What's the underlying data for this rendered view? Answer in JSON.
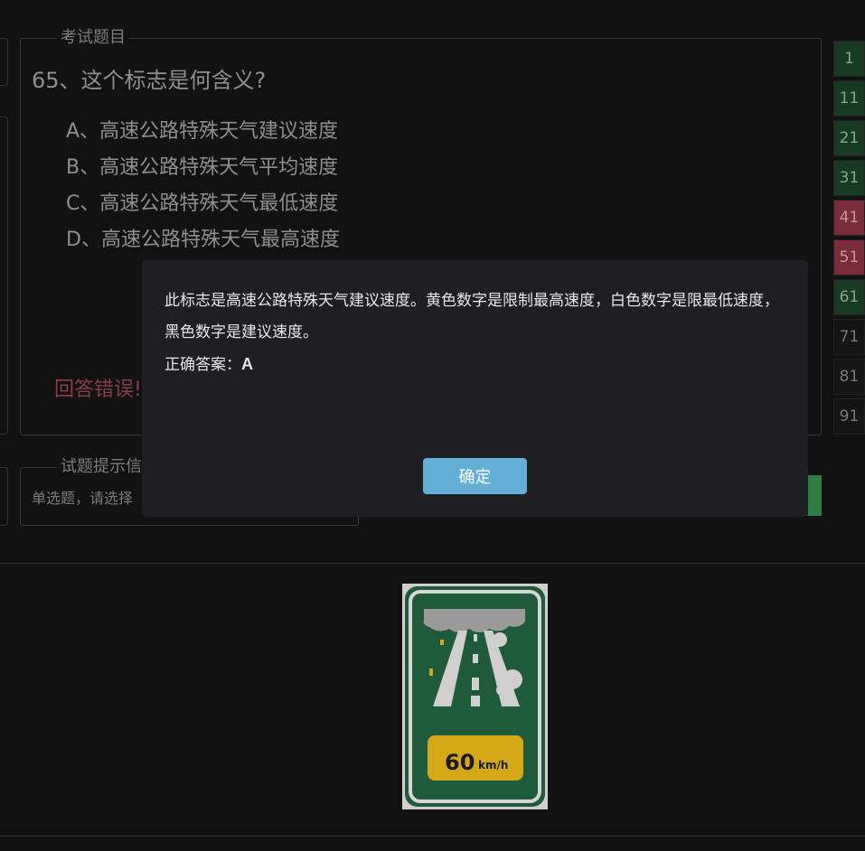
{
  "question": {
    "legend": "考试题目",
    "title": "65、这个标志是何含义?",
    "options": [
      "A、高速公路特殊天气建议速度",
      "B、高速公路特殊天气平均速度",
      "C、高速公路特殊天气最低速度",
      "D、高速公路特殊天气最高速度"
    ],
    "result": "回答错误!"
  },
  "hint": {
    "legend": "试题提示信",
    "text": "单选题，请选择"
  },
  "numbers": [
    {
      "label": "1",
      "status": "correct"
    },
    {
      "label": "11",
      "status": "correct"
    },
    {
      "label": "21",
      "status": "correct"
    },
    {
      "label": "31",
      "status": "correct"
    },
    {
      "label": "41",
      "status": "wrong"
    },
    {
      "label": "51",
      "status": "wrong"
    },
    {
      "label": "61",
      "status": "correct"
    },
    {
      "label": "71",
      "status": "unanswered"
    },
    {
      "label": "81",
      "status": "unanswered"
    },
    {
      "label": "91",
      "status": "unanswered"
    }
  ],
  "sign": {
    "speed": "60",
    "unit": "km/h"
  },
  "modal": {
    "explanation": "此标志是高速公路特殊天气建议速度。黄色数字是限制最高速度，白色数字是限最低速度，黑色数字是建议速度。",
    "answer_label": "正确答案：",
    "answer_value": "A",
    "ok_label": "确定"
  },
  "colors": {
    "correct": "#163a22",
    "wrong": "#7a2c3a",
    "ok_button": "#63afd6",
    "sign_green": "#1f5a3a",
    "sign_yellow": "#d4a817"
  }
}
